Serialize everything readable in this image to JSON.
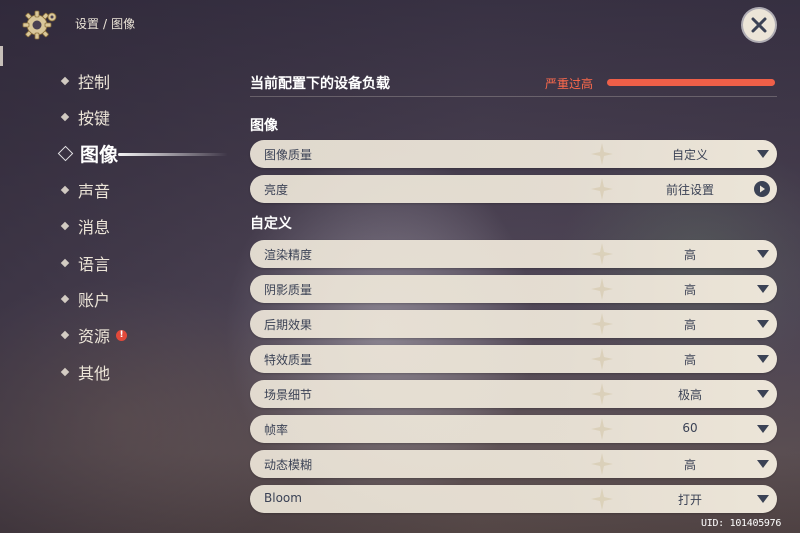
{
  "header": {
    "breadcrumb_settings": "设置",
    "breadcrumb_sep": "/",
    "breadcrumb_current": "图像"
  },
  "sidebar": {
    "items": [
      {
        "label": "控制"
      },
      {
        "label": "按键"
      },
      {
        "label": "图像",
        "active": true
      },
      {
        "label": "声音"
      },
      {
        "label": "消息"
      },
      {
        "label": "语言"
      },
      {
        "label": "账户"
      },
      {
        "label": "资源",
        "badge": "!"
      },
      {
        "label": "其他"
      }
    ]
  },
  "device_load": {
    "title": "当前配置下的设备负载",
    "status": "严重过高",
    "level": 1.0,
    "status_color": "#ef5f48"
  },
  "sections": {
    "image": {
      "title": "图像",
      "rows": [
        {
          "label": "图像质量",
          "value": "自定义",
          "control": "dropdown"
        },
        {
          "label": "亮度",
          "value": "前往设置",
          "control": "link"
        }
      ]
    },
    "custom": {
      "title": "自定义",
      "rows": [
        {
          "label": "渲染精度",
          "value": "高",
          "control": "dropdown"
        },
        {
          "label": "阴影质量",
          "value": "高",
          "control": "dropdown"
        },
        {
          "label": "后期效果",
          "value": "高",
          "control": "dropdown"
        },
        {
          "label": "特效质量",
          "value": "高",
          "control": "dropdown"
        },
        {
          "label": "场景细节",
          "value": "极高",
          "control": "dropdown"
        },
        {
          "label": "帧率",
          "value": "60",
          "control": "dropdown"
        },
        {
          "label": "动态模糊",
          "value": "高",
          "control": "dropdown"
        },
        {
          "label": "Bloom",
          "value": "打开",
          "control": "dropdown"
        }
      ]
    }
  },
  "footer": {
    "uid": "UID: 101405976"
  },
  "colors": {
    "row_bg": "#ece5d8",
    "row_text": "#3b4255",
    "accent_warning": "#ff6a4c"
  }
}
